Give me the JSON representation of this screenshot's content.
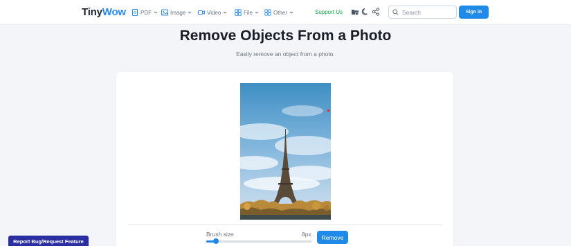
{
  "header": {
    "logo_part1": "Tiny",
    "logo_part2": "Wow",
    "nav": [
      {
        "label": "PDF",
        "icon": "pdf-icon"
      },
      {
        "label": "Image",
        "icon": "image-icon"
      },
      {
        "label": "Video",
        "icon": "video-icon"
      },
      {
        "label": "File",
        "icon": "file-icon"
      },
      {
        "label": "Other",
        "icon": "grid-icon"
      }
    ],
    "support_label": "Support Us",
    "icons": [
      "folder-icon",
      "moon-icon",
      "share-icon"
    ],
    "search_placeholder": "Search",
    "signin_label": "Sign in"
  },
  "main": {
    "title": "Remove Objects From a Photo",
    "subtitle": "Easily remove an object from a photo.",
    "brush_label": "Brush size",
    "brush_value": "8px",
    "brush_level": 0.09,
    "remove_label": "Remove"
  },
  "footer": {
    "report_label": "Report Bug/Request Feature"
  },
  "colors": {
    "accent": "#1f8ae8",
    "support": "#16a34a",
    "report_bg": "#2a2ea0"
  }
}
